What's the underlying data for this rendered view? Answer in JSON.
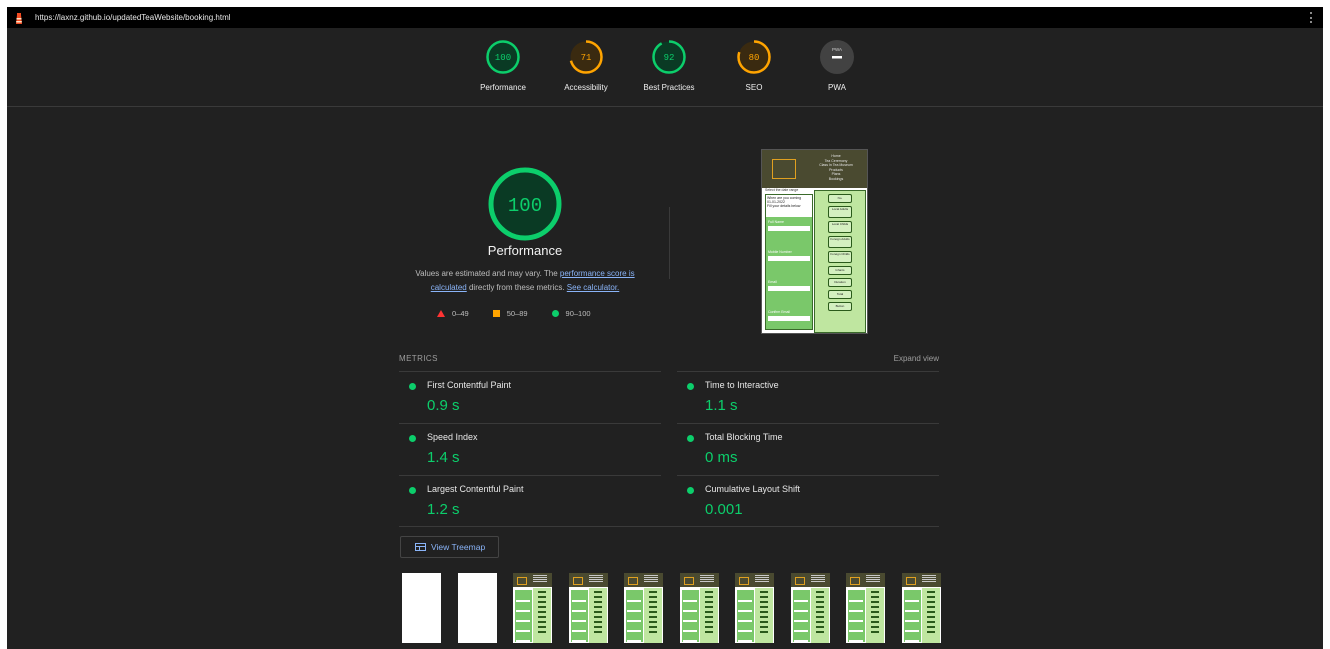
{
  "url_bar": {
    "url": "https://laxnz.github.io/updatedTeaWebsite/booking.html"
  },
  "scores": [
    {
      "label": "Performance",
      "score": "100",
      "value": 100,
      "color": "#0cce6b"
    },
    {
      "label": "Accessibility",
      "score": "71",
      "value": 71,
      "color": "#ffa400"
    },
    {
      "label": "Best Practices",
      "score": "92",
      "value": 92,
      "color": "#0cce6b"
    },
    {
      "label": "SEO",
      "score": "80",
      "value": 80,
      "color": "#ffa400"
    },
    {
      "label": "PWA",
      "score": "PWA",
      "value": null,
      "color": "#9e9e9e"
    }
  ],
  "performance": {
    "score": "100",
    "title": "Performance",
    "desc_prefix": "Values are estimated and may vary. The ",
    "desc_link1": "performance score is calculated",
    "desc_middle": " directly from these metrics. ",
    "desc_link2": "See calculator."
  },
  "legend": {
    "fail": "0–49",
    "average": "50–89",
    "pass": "90–100"
  },
  "metrics_section": {
    "title": "METRICS",
    "expand": "Expand view",
    "items": [
      {
        "name": "First Contentful Paint",
        "value": "0.9 s"
      },
      {
        "name": "Time to Interactive",
        "value": "1.1 s"
      },
      {
        "name": "Speed Index",
        "value": "1.4 s"
      },
      {
        "name": "Total Blocking Time",
        "value": "0 ms"
      },
      {
        "name": "Largest Contentful Paint",
        "value": "1.2 s"
      },
      {
        "name": "Cumulative Layout Shift",
        "value": "0.001"
      }
    ]
  },
  "treemap": {
    "label": "View Treemap"
  },
  "screenshot_preview": {
    "nav_lines": [
      "Home",
      "Tea Ceremony",
      "Class In Tea Museum",
      "Products",
      "Plans",
      "Bookings"
    ],
    "form_labels": [
      "Select the date range",
      "When are you coming",
      "01-01-2022",
      "Fill your details below",
      "Full Name",
      "Mobile Number",
      "Email",
      "Confirm Email"
    ],
    "side_buttons": [
      "No.",
      "Local Adults",
      "Local Childs",
      "Foreign Adults",
      "Foreign Childs",
      "Infants",
      "Duration",
      "Total",
      "Button"
    ]
  },
  "filmstrip": {
    "frames": [
      "blank",
      "blank",
      "rendered",
      "rendered",
      "rendered",
      "rendered",
      "rendered",
      "rendered",
      "rendered",
      "rendered"
    ]
  },
  "colors": {
    "pass": "#0cce6b",
    "average": "#ffa400",
    "fail": "#ff3333",
    "link": "#8ab4f8",
    "background": "#212121"
  }
}
